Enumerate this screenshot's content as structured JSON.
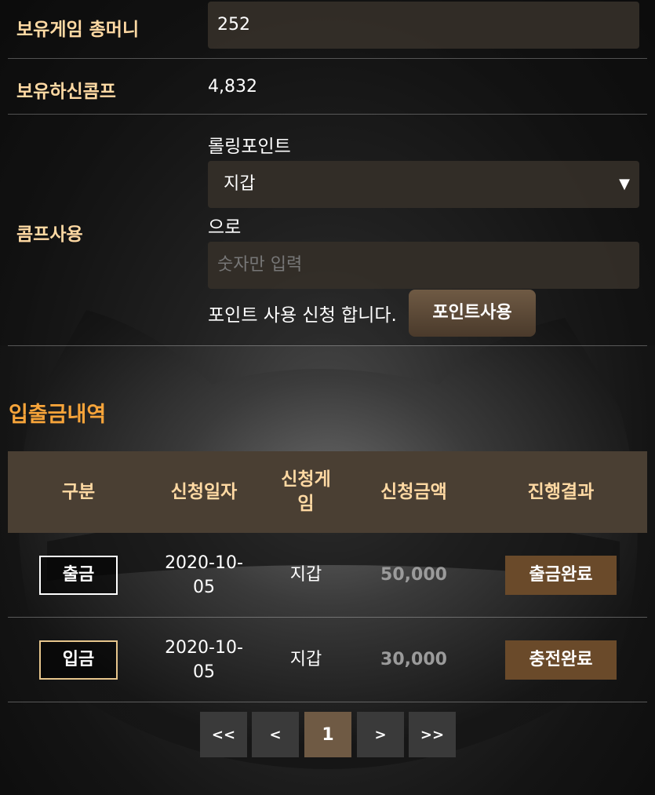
{
  "money": {
    "label": "보유게임 총머니",
    "value": "252"
  },
  "comp": {
    "label": "보유하신콤프",
    "value": "4,832"
  },
  "comp_use": {
    "label": "콤프사용",
    "rolling_label": "롤링포인트",
    "wallet_selected": "지갑",
    "to_label": "으로",
    "amount_placeholder": "숫자만 입력",
    "apply_text": "포인트 사용 신청 합니다.",
    "apply_button": "포인트사용"
  },
  "history": {
    "title": "입출금내역",
    "columns": [
      "구분",
      "신청일자",
      "신청게임",
      "신청금액",
      "진행결과"
    ],
    "col_game_lines": [
      "신청게",
      "임"
    ],
    "rows": [
      {
        "type": "출금",
        "date_line1": "2020-10-",
        "date_line2": "05",
        "game": "지갑",
        "amount": "50,000",
        "status": "출금완료"
      },
      {
        "type": "입금",
        "date_line1": "2020-10-",
        "date_line2": "05",
        "game": "지갑",
        "amount": "30,000",
        "status": "충전완료"
      }
    ]
  },
  "pagination": {
    "first": "<<",
    "prev": "<",
    "current": "1",
    "next": ">",
    "last": ">>"
  },
  "colors": {
    "label": "#ffd9a3",
    "section_title": "#f7a43a",
    "table_header_bg": "#4a3f33",
    "status_bg": "#6a4a2a",
    "button_brown": "#6f5a44"
  }
}
